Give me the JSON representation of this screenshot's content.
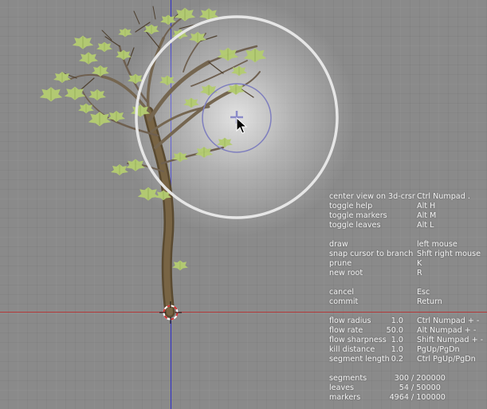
{
  "help": {
    "view": [
      {
        "label": "center view on 3d-crsr",
        "key": "Ctrl  Numpad ."
      },
      {
        "label": "toggle help",
        "key": "Alt H"
      },
      {
        "label": "toggle markers",
        "key": "Alt M"
      },
      {
        "label": "toggle leaves",
        "key": "Alt L"
      }
    ],
    "actions": [
      {
        "label": "draw",
        "key": "left mouse"
      },
      {
        "label": "snap cursor to branch",
        "key": "Shft right mouse"
      },
      {
        "label": "prune",
        "key": "K"
      },
      {
        "label": "new root",
        "key": "R"
      }
    ],
    "confirm": [
      {
        "label": "cancel",
        "key": "Esc"
      },
      {
        "label": "commit",
        "key": "Return"
      }
    ],
    "params": [
      {
        "label": "flow radius",
        "value": "1.0",
        "key": "Ctrl  Numpad + -"
      },
      {
        "label": "flow rate",
        "value": "50.0",
        "key": "Alt   Numpad + -"
      },
      {
        "label": "flow sharpness",
        "value": "1.0",
        "key": "Shift Numpad + -"
      },
      {
        "label": "kill distance",
        "value": "1.0",
        "key": "PgUp/PgDn"
      },
      {
        "label": "segment length",
        "value": "0.2",
        "key": "Ctrl PgUp/PgDn"
      }
    ],
    "stats": [
      {
        "label": "segments",
        "value": "300",
        "max": "/ 200000"
      },
      {
        "label": "leaves",
        "value": "54",
        "max": "/   50000"
      },
      {
        "label": "markers",
        "value": "4964",
        "max": "/ 100000"
      }
    ]
  },
  "colors": {
    "axis_x": "#b43a3a",
    "axis_y": "#2e2ec8",
    "trunk": "#6e5a3a",
    "leaf": "#b4cc72",
    "brush_ring": "#e6e6e6",
    "inner_ring": "#7f7fbe"
  },
  "icons": [
    "3d-cursor-icon",
    "crosshair-icon",
    "mouse-pointer-icon"
  ]
}
